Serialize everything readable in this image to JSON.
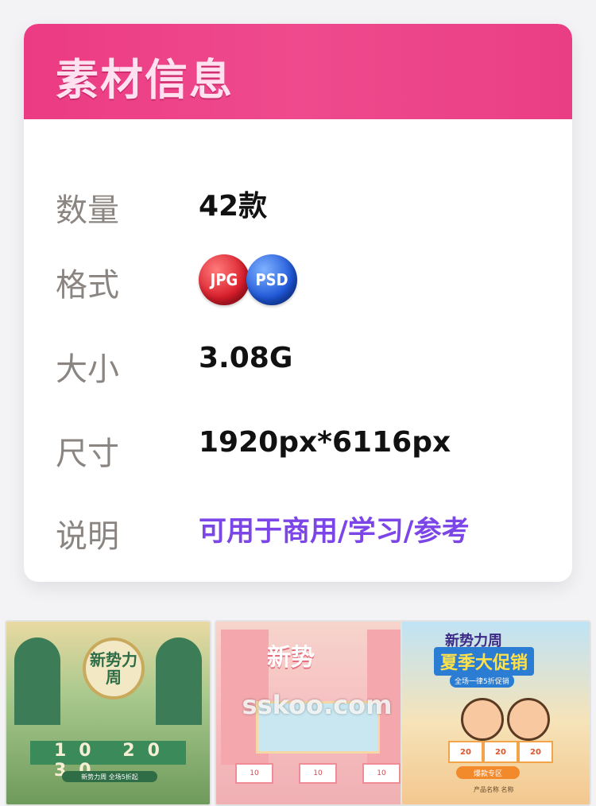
{
  "card": {
    "title": "素材信息",
    "rows": [
      {
        "label": "数量",
        "value": "42款"
      },
      {
        "label": "格式",
        "badges": [
          "JPG",
          "PSD"
        ]
      },
      {
        "label": "大小",
        "value": "3.08G"
      },
      {
        "label": "尺寸",
        "value": "1920px*6116px"
      },
      {
        "label": "说明",
        "value": "可用于商用/学习/参考"
      }
    ]
  },
  "colors": {
    "header": "#ec3b83",
    "note": "#7c45e8",
    "jpg": "#d81d2b",
    "psd": "#1f57d8"
  },
  "thumbnails": [
    {
      "heading": "新势力周",
      "numbers": "10 20 30",
      "bar": "新势力周 全场5折起"
    },
    {
      "heading": "新势",
      "coupons": [
        "10",
        "10",
        "10"
      ],
      "watermark": "sskoo.com"
    },
    {
      "heading": "新势力周",
      "promo": "夏季大促销",
      "sub": "全场一律5折促销",
      "coupons": [
        "20",
        "20",
        "20"
      ],
      "zone": "爆款专区",
      "product": "产品名称 名称"
    }
  ]
}
